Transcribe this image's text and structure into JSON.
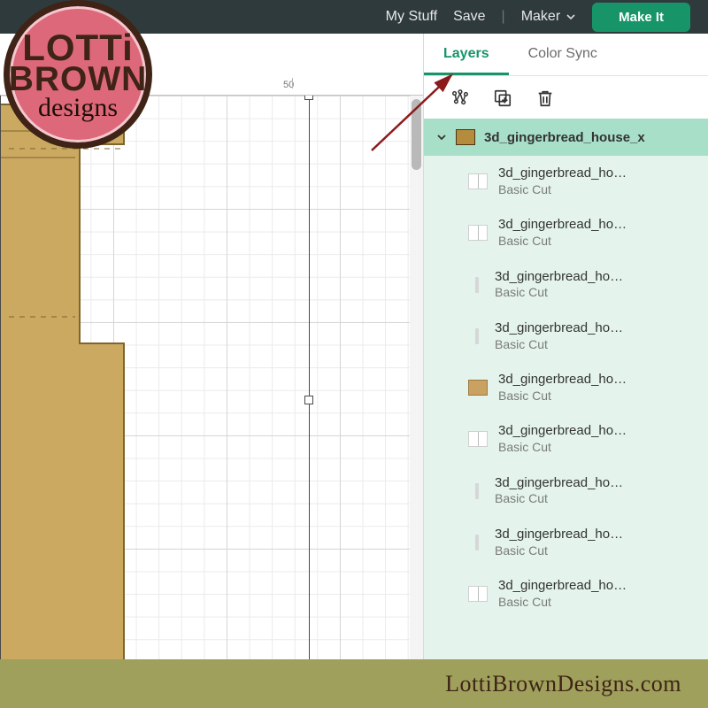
{
  "topbar": {
    "my_stuff": "My Stuff",
    "save": "Save",
    "divider": "|",
    "machine": "Maker",
    "make_it": "Make It"
  },
  "ruler": {
    "mark_50": "50"
  },
  "panel": {
    "tabs": {
      "layers": "Layers",
      "colorsync": "Color Sync"
    },
    "toolbar": {
      "ungroup": "ungroup-icon",
      "duplicate": "duplicate-icon",
      "delete": "trash-icon"
    },
    "group": {
      "name": "3d_gingerbread_house_x"
    },
    "layers": [
      {
        "name": "3d_gingerbread_ho…",
        "op": "Basic Cut",
        "swatch": "line"
      },
      {
        "name": "3d_gingerbread_ho…",
        "op": "Basic Cut",
        "swatch": "line"
      },
      {
        "name": "3d_gingerbread_ho…",
        "op": "Basic Cut",
        "swatch": "stripe"
      },
      {
        "name": "3d_gingerbread_ho…",
        "op": "Basic Cut",
        "swatch": "stripe"
      },
      {
        "name": "3d_gingerbread_ho…",
        "op": "Basic Cut",
        "swatch": "tan"
      },
      {
        "name": "3d_gingerbread_ho…",
        "op": "Basic Cut",
        "swatch": "line"
      },
      {
        "name": "3d_gingerbread_ho…",
        "op": "Basic Cut",
        "swatch": "stripe"
      },
      {
        "name": "3d_gingerbread_ho…",
        "op": "Basic Cut",
        "swatch": "stripe"
      },
      {
        "name": "3d_gingerbread_ho…",
        "op": "Basic Cut",
        "swatch": "line"
      }
    ]
  },
  "watermark": {
    "logo_l1": "LOTTi",
    "logo_l2": "BROWN",
    "logo_l3": "designs",
    "footer": "LottiBrownDesigns.com"
  }
}
